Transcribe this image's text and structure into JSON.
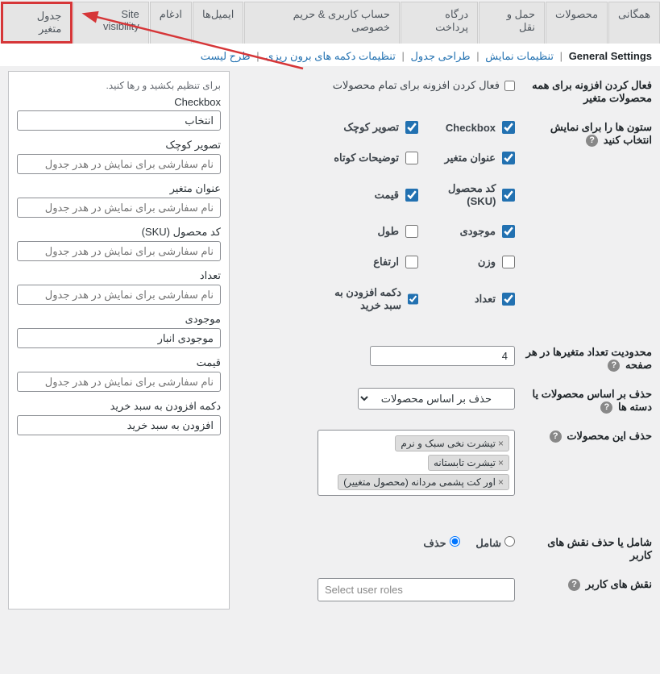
{
  "tabs": {
    "t0": "همگانی",
    "t1": "محصولات",
    "t2": "حمل و نقل",
    "t3": "درگاه پرداخت",
    "t4": "حساب کاربری & حریم خصوصی",
    "t5": "ایمیل‌ها",
    "t6": "ادغام",
    "t7": "Site visibility",
    "t8": "جدول متغیر"
  },
  "subnav": {
    "current": "General Settings",
    "l1": "تنظیمات نمایش",
    "l2": "طراحی جدول",
    "l3": "تنظیمات دکمه های برون ریزی",
    "l4": "طرح لیست"
  },
  "f_enable": {
    "label": "فعال کردن افزونه برای همه محصولات متغیر",
    "cb": "فعال کردن افزونه برای تمام محصولات"
  },
  "f_cols": {
    "label": "ستون ها را برای نمایش انتخاب کنید",
    "c_checkbox": "Checkbox",
    "c_thumb": "تصویر کوچک",
    "c_title": "عنوان متغیر",
    "c_desc": "توضیحات کوتاه",
    "c_sku": "کد محصول (SKU)",
    "c_price": "قیمت",
    "c_stock": "موجودی",
    "c_length": "طول",
    "c_weight": "وزن",
    "c_height": "ارتفاع",
    "c_qty": "تعداد",
    "c_cart": "دکمه افزودن به سبد خرید"
  },
  "f_limit": {
    "label": "محدودیت تعداد متغیرها در هر صفحه",
    "value": "4"
  },
  "f_exclude_by": {
    "label": "حذف بر اساس محصولات یا دسته ها",
    "value": "حذف بر اساس محصولات"
  },
  "f_exclude_prod": {
    "label": "حذف این محصولات",
    "tag1": "تیشرت نخی سبک و نرم",
    "tag2": "تیشرت تابستانه",
    "tag3": "اور کت پشمی مردانه (محصول متغییر)"
  },
  "f_roles_incexc": {
    "label": "شامل یا حذف نقش های کاربر",
    "r1": "شامل",
    "r2": "حذف"
  },
  "f_roles": {
    "label": "نقش های کاربر",
    "ph": "Select user roles"
  },
  "sortable": {
    "hint": "برای تنظیم بکشید و رها کنید.",
    "ph": "نام سفارشی برای نمایش در هدر جدول",
    "i_checkbox": "Checkbox",
    "i_checkbox_v": "انتخاب",
    "i_thumb": "تصویر کوچک",
    "i_title": "عنوان متغیر",
    "i_sku": "کد محصول (SKU)",
    "i_qty": "تعداد",
    "i_stock": "موجودی",
    "i_stock_v": "موجودی انبار",
    "i_price": "قیمت",
    "i_cart": "دکمه افزودن به سبد خرید",
    "i_cart_v": "افزودن به سبد خرید"
  }
}
